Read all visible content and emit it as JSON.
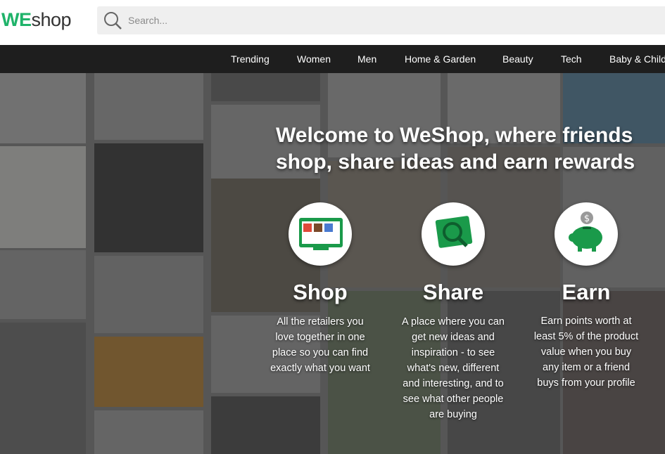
{
  "logo": {
    "we": "WE",
    "shop": "shop"
  },
  "search": {
    "placeholder": "Search..."
  },
  "nav": {
    "items": [
      "Trending",
      "Women",
      "Men",
      "Home & Garden",
      "Beauty",
      "Tech",
      "Baby & Child"
    ]
  },
  "hero": {
    "headline_line1": "Welcome to WeShop, where friends",
    "headline_line2": "shop, share ideas and earn rewards",
    "features": [
      {
        "title": "Shop",
        "icon": "browser-window-icon",
        "lines": [
          "All the retailers you",
          "love together in one",
          "place so you can find",
          "exactly what you want"
        ]
      },
      {
        "title": "Share",
        "icon": "magnifier-card-icon",
        "lines": [
          "A place where you can",
          "get new ideas and",
          "inspiration - to see",
          "what's new, different",
          "and interesting, and to",
          "see what other people",
          "are buying"
        ]
      },
      {
        "title": "Earn",
        "icon": "piggy-bank-icon",
        "lines": [
          "Earn points worth at",
          "least 5% of the product",
          "value when you buy",
          "any item or a friend",
          "buys from your profile"
        ]
      }
    ]
  },
  "colors": {
    "brand_green": "#1fb36a",
    "nav_bg": "#1e1e1e",
    "icon_green": "#1a9a4a"
  }
}
